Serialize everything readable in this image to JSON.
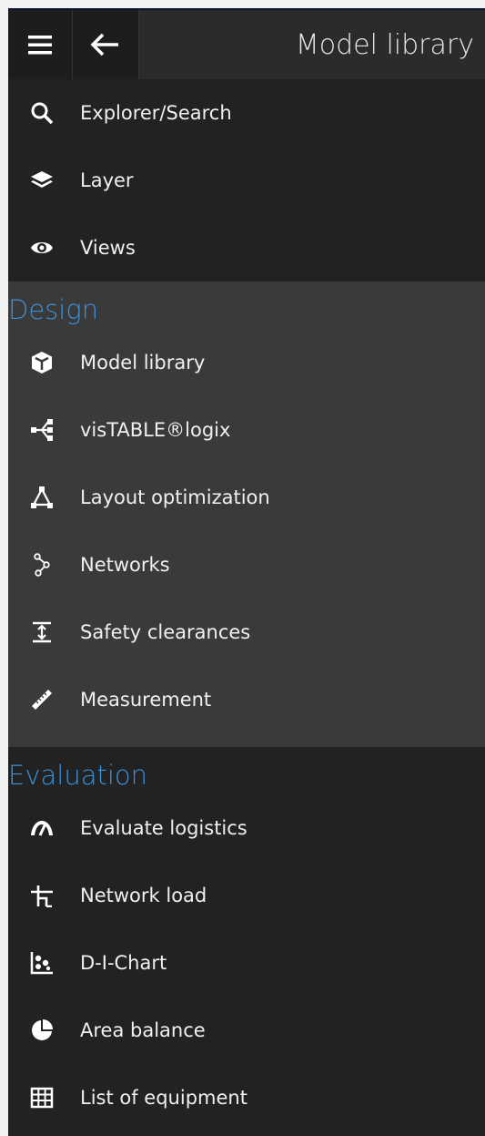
{
  "header": {
    "title": "Model library"
  },
  "top_items": [
    {
      "label": "Explorer/Search",
      "icon": "search-icon"
    },
    {
      "label": "Layer",
      "icon": "layers-icon"
    },
    {
      "label": "Views",
      "icon": "eye-icon"
    }
  ],
  "design": {
    "heading": "Design",
    "items": [
      {
        "label": "Model library",
        "icon": "cube-icon"
      },
      {
        "label": "visTABLE®logix",
        "icon": "flow-icon"
      },
      {
        "label": "Layout optimization",
        "icon": "network-triangle-icon"
      },
      {
        "label": "Networks",
        "icon": "network-path-icon"
      },
      {
        "label": "Safety clearances",
        "icon": "clearance-icon"
      },
      {
        "label": "Measurement",
        "icon": "ruler-icon"
      }
    ]
  },
  "evaluation": {
    "heading": "Evaluation",
    "items": [
      {
        "label": "Evaluate logistics",
        "icon": "gauge-icon"
      },
      {
        "label": "Network load",
        "icon": "network-load-icon"
      },
      {
        "label": "D-I-Chart",
        "icon": "scatter-chart-icon"
      },
      {
        "label": "Area balance",
        "icon": "pie-chart-icon"
      },
      {
        "label": "List of equipment",
        "icon": "table-icon"
      }
    ]
  },
  "colors": {
    "accent": "#3d8fd6",
    "panel": "#222222",
    "design_bg": "#3a3a3a"
  }
}
